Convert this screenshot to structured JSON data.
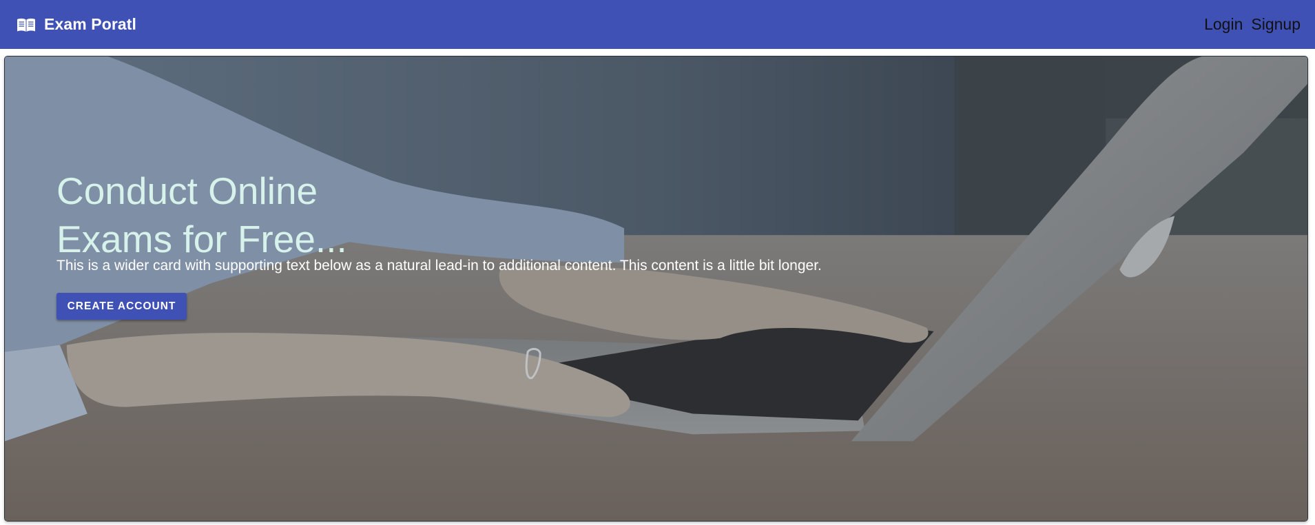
{
  "header": {
    "brand_icon": "book-icon",
    "title": "Exam Poratl",
    "nav": {
      "login": "Login",
      "signup": "Signup"
    },
    "colors": {
      "primary": "#3f51b5"
    }
  },
  "hero": {
    "title_line1": "Conduct Online",
    "title_line2": "Exams for Free...",
    "text": "This is a wider card with supporting text below as a natural lead-in to additional content. This content is a little bit longer.",
    "button_label": "CREATE ACCOUNT",
    "background_image": "hands typing on laptop on wooden table"
  }
}
